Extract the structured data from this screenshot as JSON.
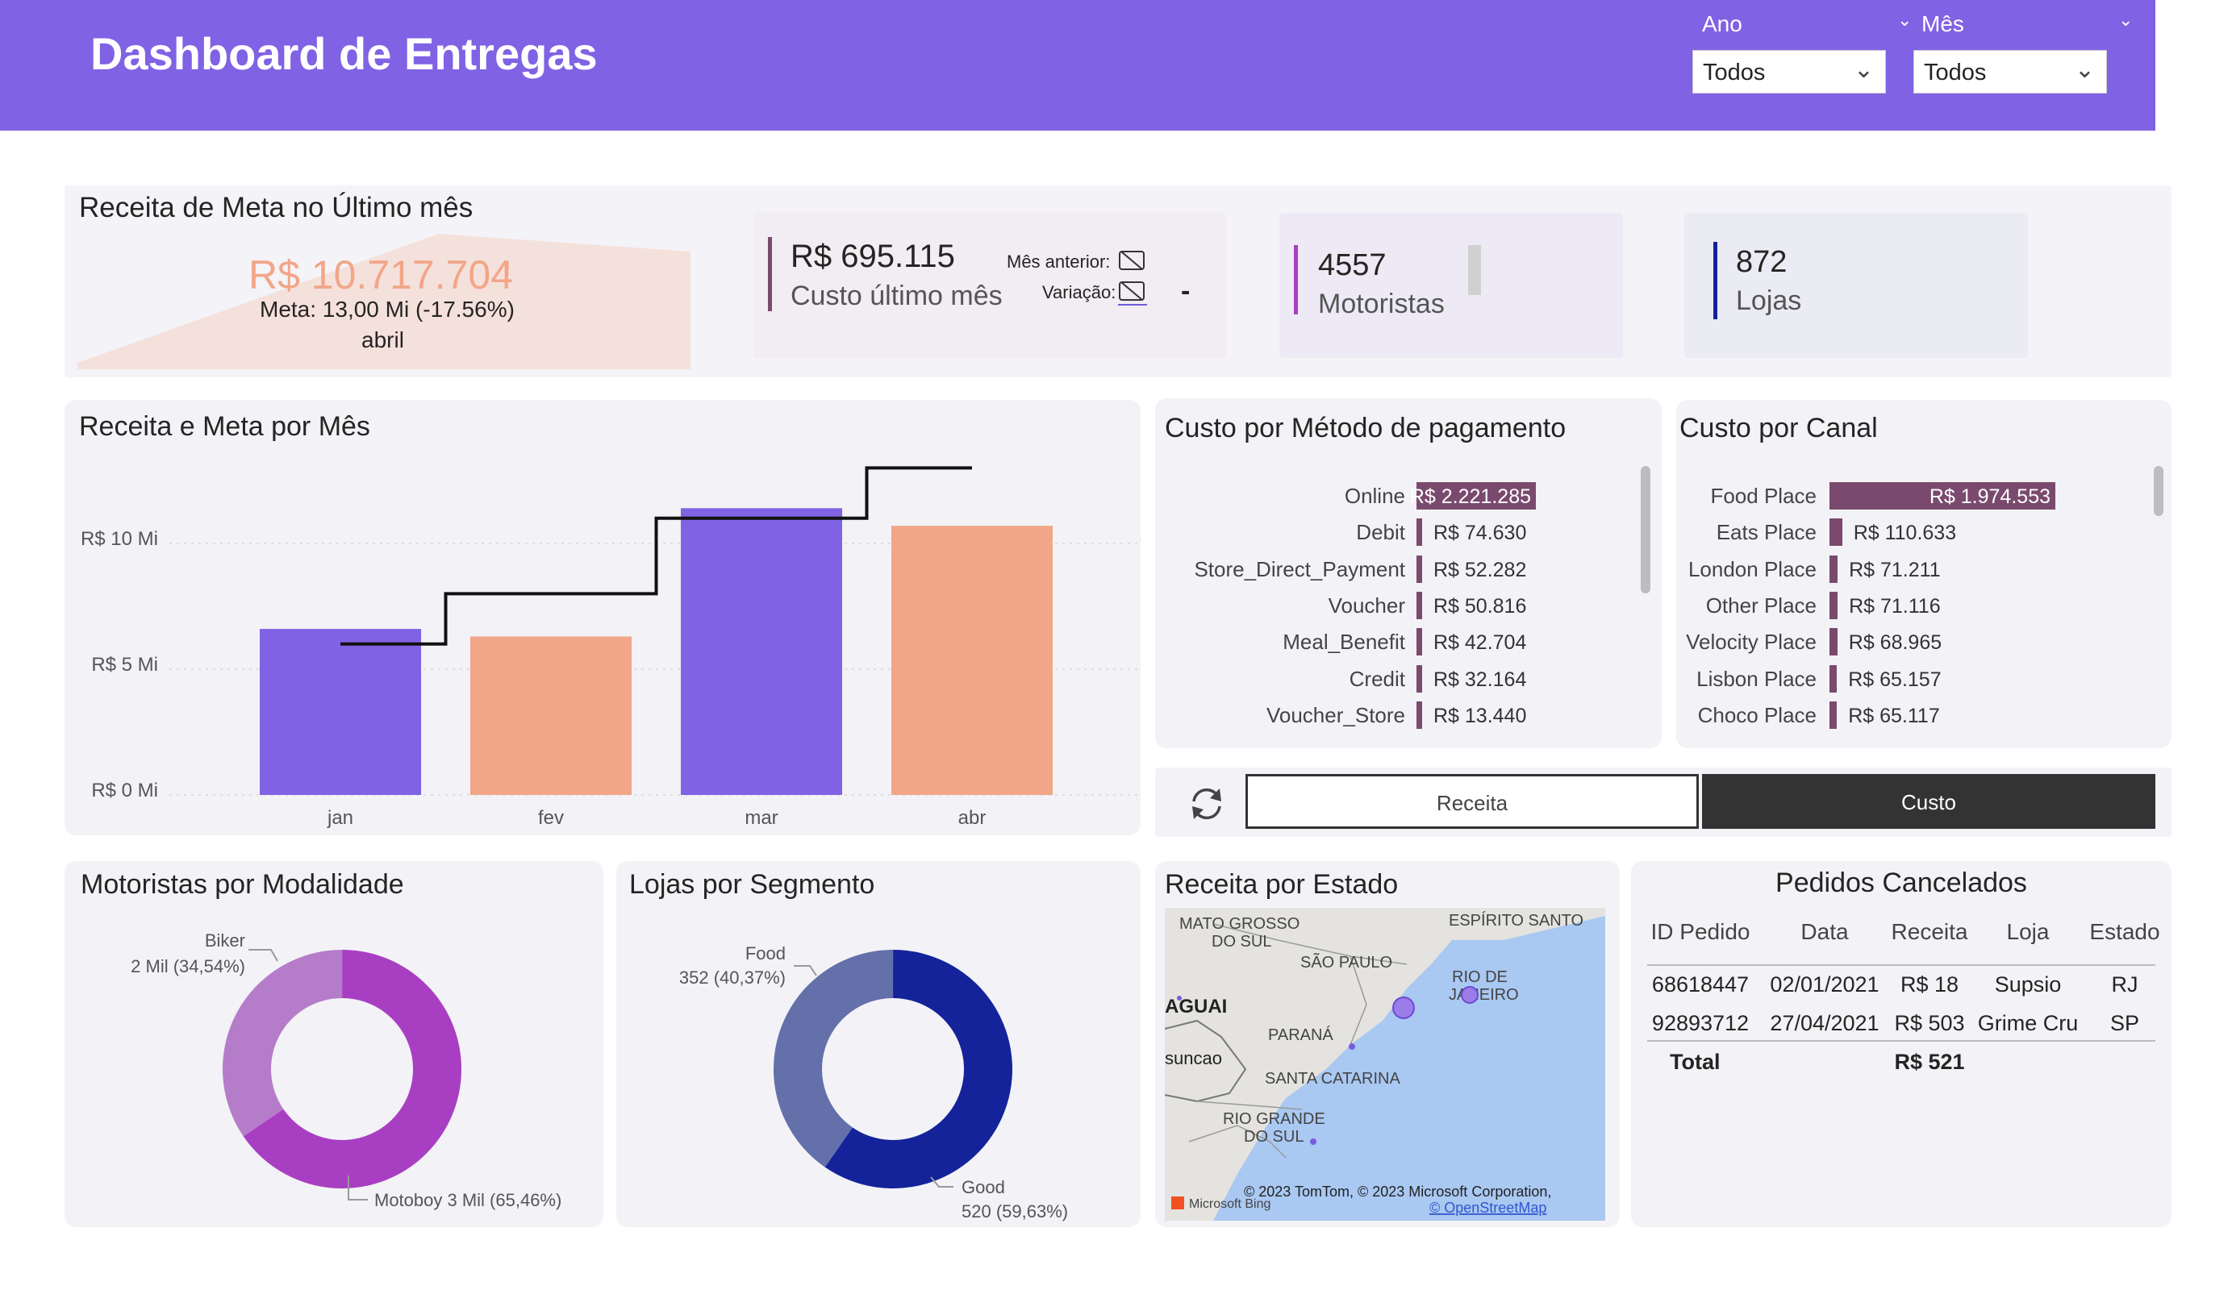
{
  "header": {
    "title": "Dashboard de Entregas",
    "filters": [
      {
        "label": "Ano",
        "value": "Todos"
      },
      {
        "label": "Mês",
        "value": "Todos"
      }
    ]
  },
  "kpi_meta": {
    "title": "Receita de Meta no Último mês",
    "value": "R$ 10.717.704",
    "alert": "!",
    "goal_text": "Meta: 13,00 Mi (-17.56%)",
    "month": "abril"
  },
  "kpi_custo": {
    "value": "R$ 695.115",
    "label": "Custo último mês",
    "prev_label": "Mês anterior:",
    "var_label": "Variação:",
    "var_value": "-"
  },
  "kpi_motoristas": {
    "value": "4557",
    "label": "Motoristas"
  },
  "kpi_lojas": {
    "value": "872",
    "label": "Lojas"
  },
  "receita_meta": {
    "title": "Receita e Meta por Mês",
    "y_ticks": [
      "R$ 0 Mi",
      "R$ 5 Mi",
      "R$ 10 Mi"
    ],
    "chart_data": {
      "type": "bar",
      "categories": [
        "jan",
        "fev",
        "mar",
        "abr"
      ],
      "series": [
        {
          "values": [
            6.6,
            6.3,
            11.4,
            10.7
          ]
        },
        {
          "values": [
            6.0,
            8.0,
            11.0,
            13.0
          ]
        }
      ],
      "ylim": [
        0,
        13
      ],
      "colors": [
        "#8062e4",
        "#f2a688",
        "#8062e4",
        "#f2a688"
      ]
    }
  },
  "pagamento": {
    "title": "Custo por Método de pagamento",
    "rows": [
      {
        "label": "Online",
        "value": "R$ 2.221.285",
        "num": 2221285
      },
      {
        "label": "Debit",
        "value": "R$ 74.630",
        "num": 74630
      },
      {
        "label": "Store_Direct_Payment",
        "value": "R$ 52.282",
        "num": 52282
      },
      {
        "label": "Voucher",
        "value": "R$ 50.816",
        "num": 50816
      },
      {
        "label": "Meal_Benefit",
        "value": "R$ 42.704",
        "num": 42704
      },
      {
        "label": "Credit",
        "value": "R$ 32.164",
        "num": 32164
      },
      {
        "label": "Voucher_Store",
        "value": "R$ 13.440",
        "num": 13440
      }
    ]
  },
  "canal": {
    "title": "Custo por Canal",
    "rows": [
      {
        "label": "Food Place",
        "value": "R$ 1.974.553",
        "num": 1974553
      },
      {
        "label": "Eats Place",
        "value": "R$ 110.633",
        "num": 110633
      },
      {
        "label": "London Place",
        "value": "R$ 71.211",
        "num": 71211
      },
      {
        "label": "Other Place",
        "value": "R$ 71.116",
        "num": 71116
      },
      {
        "label": "Velocity Place",
        "value": "R$ 68.965",
        "num": 68965
      },
      {
        "label": "Lisbon Place",
        "value": "R$ 65.157",
        "num": 65157
      },
      {
        "label": "Choco Place",
        "value": "R$ 65.117",
        "num": 65117
      }
    ]
  },
  "toggle": {
    "receita": "Receita",
    "custo": "Custo"
  },
  "modalidade": {
    "title": "Motoristas por Modalidade",
    "chart_data": {
      "type": "pie",
      "categories": [
        "Biker",
        "Motoboy"
      ],
      "values": [
        34.54,
        65.46
      ],
      "labels": [
        "2 Mil (34,54%)",
        "3 Mil (65,46%)"
      ],
      "colors": [
        "#b57cc9",
        "#a83fc2"
      ]
    },
    "biker_label": "Biker",
    "biker_value": "2 Mil (34,54%)",
    "motoboy_label": "Motoboy 3 Mil (65,46%)"
  },
  "segmento": {
    "title": "Lojas por Segmento",
    "chart_data": {
      "type": "pie",
      "categories": [
        "Food",
        "Good"
      ],
      "values": [
        40.37,
        59.63
      ],
      "labels": [
        "352 (40,37%)",
        "520 (59,63%)"
      ],
      "colors": [
        "#6470aa",
        "#14239a"
      ]
    },
    "food_label": "Food",
    "food_value": "352 (40,37%)",
    "good_label": "Good",
    "good_value": "520 (59,63%)"
  },
  "estado": {
    "title": "Receita por Estado",
    "places": [
      "MATO GROSSO",
      "DO SUL",
      "ESPÍRITO SANTO",
      "SÃO PAULO",
      "RIO DE",
      "JANEIRO",
      "AGUAI",
      "PARANÁ",
      "suncao",
      "SANTA CATARINA",
      "RIO GRANDE",
      "DO SUL"
    ],
    "credit": "© 2023 TomTom, © 2023 Microsoft Corporation,",
    "osm": "© OpenStreetMap",
    "bing": "Microsoft Bing"
  },
  "cancelados": {
    "title": "Pedidos Cancelados",
    "columns": [
      "ID Pedido",
      "Data",
      "Receita",
      "Loja",
      "Estado"
    ],
    "rows": [
      [
        "68618447",
        "02/01/2021",
        "R$ 18",
        "Supsio",
        "RJ"
      ],
      [
        "92893712",
        "27/04/2021",
        "R$ 503",
        "Grime Cru",
        "SP"
      ]
    ],
    "total_label": "Total",
    "total_value": "R$ 521"
  }
}
